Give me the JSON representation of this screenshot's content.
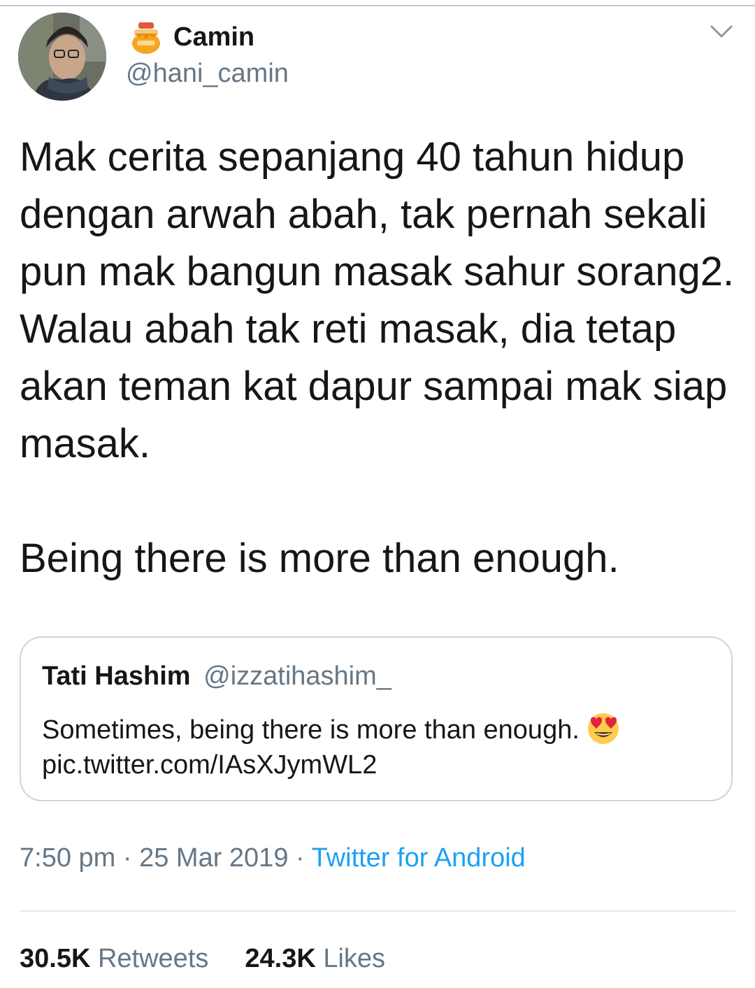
{
  "author": {
    "display_name": "Camin",
    "handle": "@hani_camin",
    "avatar_icon": "profile-photo",
    "badge_icon": "honey-pot-emoji"
  },
  "tweet": {
    "paragraph1": "Mak cerita sepanjang 40 tahun hidup dengan arwah abah, tak pernah sekali pun mak bangun masak sahur sorang2. Walau abah tak reti masak, dia tetap akan teman kat dapur sampai mak siap masak.",
    "paragraph2": "Being there is more than enough."
  },
  "quoted_tweet": {
    "name": "Tati Hashim",
    "handle": "@izzatihashim_",
    "text": "Sometimes, being there is more than enough.",
    "emoji_icon": "heart-eyes-emoji",
    "link": "pic.twitter.com/IAsXJymWL2"
  },
  "meta": {
    "time": "7:50 pm",
    "separator": " · ",
    "date": "25 Mar 2019",
    "source": "Twitter for Android"
  },
  "stats": {
    "retweets_count": "30.5K",
    "retweets_label": "Retweets",
    "likes_count": "24.3K",
    "likes_label": "Likes"
  },
  "colors": {
    "text": "#14171a",
    "secondary": "#657786",
    "link": "#1da1f2",
    "border": "#ccd6dd"
  }
}
